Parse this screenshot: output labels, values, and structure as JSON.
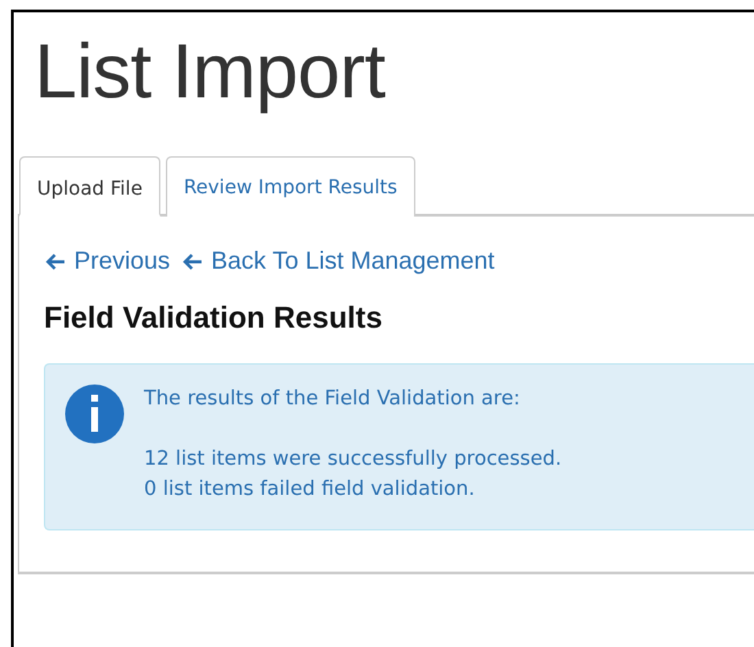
{
  "page_title": "List Import",
  "tabs": [
    {
      "label": "Upload File",
      "selected": true
    },
    {
      "label": "Review Import Results",
      "selected": false
    }
  ],
  "nav_links": [
    {
      "label": "Previous"
    },
    {
      "label": "Back To List Management"
    }
  ],
  "section_title": "Field Validation Results",
  "alert": {
    "intro": "The results of the Field Validation are:",
    "lines": [
      "12 list items were successfully processed.",
      "0 list items failed field validation."
    ]
  }
}
